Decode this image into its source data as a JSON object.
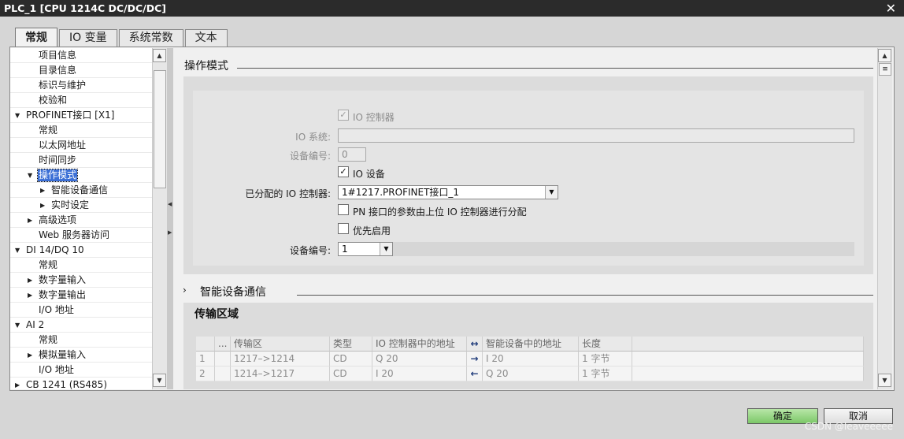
{
  "window": {
    "title": "PLC_1 [CPU 1214C DC/DC/DC]",
    "close": "✕"
  },
  "tabs": [
    {
      "label": "常规",
      "active": true
    },
    {
      "label": "IO 变量",
      "active": false
    },
    {
      "label": "系统常数",
      "active": false
    },
    {
      "label": "文本",
      "active": false
    }
  ],
  "tree": {
    "items": [
      {
        "label": "项目信息",
        "depth": 1,
        "arrow": ""
      },
      {
        "label": "目录信息",
        "depth": 1,
        "arrow": ""
      },
      {
        "label": "标识与维护",
        "depth": 1,
        "arrow": ""
      },
      {
        "label": "校验和",
        "depth": 1,
        "arrow": ""
      },
      {
        "label": "PROFINET接口 [X1]",
        "depth": 0,
        "arrow": "▼"
      },
      {
        "label": "常规",
        "depth": 1,
        "arrow": ""
      },
      {
        "label": "以太网地址",
        "depth": 1,
        "arrow": ""
      },
      {
        "label": "时间同步",
        "depth": 1,
        "arrow": ""
      },
      {
        "label": "操作模式",
        "depth": 1,
        "arrow": "▼",
        "selected": true
      },
      {
        "label": "智能设备通信",
        "depth": 2,
        "arrow": "▶"
      },
      {
        "label": "实时设定",
        "depth": 2,
        "arrow": "▶"
      },
      {
        "label": "高级选项",
        "depth": 1,
        "arrow": "▶"
      },
      {
        "label": "Web 服务器访问",
        "depth": 1,
        "arrow": ""
      },
      {
        "label": "DI 14/DQ 10",
        "depth": 0,
        "arrow": "▼"
      },
      {
        "label": "常规",
        "depth": 1,
        "arrow": ""
      },
      {
        "label": "数字量输入",
        "depth": 1,
        "arrow": "▶"
      },
      {
        "label": "数字量输出",
        "depth": 1,
        "arrow": "▶"
      },
      {
        "label": "I/O 地址",
        "depth": 1,
        "arrow": ""
      },
      {
        "label": "AI 2",
        "depth": 0,
        "arrow": "▼"
      },
      {
        "label": "常规",
        "depth": 1,
        "arrow": ""
      },
      {
        "label": "模拟量输入",
        "depth": 1,
        "arrow": "▶"
      },
      {
        "label": "I/O 地址",
        "depth": 1,
        "arrow": ""
      },
      {
        "label": "CB 1241 (RS485)",
        "depth": 0,
        "arrow": "▶"
      }
    ]
  },
  "section_operating_mode": {
    "title": "操作模式",
    "io_controller": {
      "label": "IO 控制器",
      "checked": true,
      "disabled": true
    },
    "io_system": {
      "label": "IO 系统:",
      "value": ""
    },
    "device_number_disabled": {
      "label": "设备编号:",
      "value": "0"
    },
    "io_device": {
      "label": "IO 设备",
      "checked": true
    },
    "assigned_controller": {
      "label": "已分配的 IO 控制器:",
      "value": "1#1217.PROFINET接口_1"
    },
    "pn_params": {
      "label": "PN 接口的参数由上位 IO 控制器进行分配",
      "checked": false
    },
    "priority_startup": {
      "label": "优先启用",
      "checked": false
    },
    "device_number": {
      "label": "设备编号:",
      "value": "1"
    }
  },
  "section_intelligent": {
    "title": "智能设备通信",
    "expand_arrow": "›",
    "transfer_title": "传输区域",
    "columns": [
      "",
      "...",
      "传输区",
      "类型",
      "IO 控制器中的地址",
      "↔",
      "智能设备中的地址",
      "长度"
    ],
    "rows": [
      {
        "num": "1",
        "name": "1217–>1214",
        "type": "CD",
        "ctrl_addr": "Q 20",
        "dir": "→",
        "dev_addr": "I 20",
        "len": "1 字节"
      },
      {
        "num": "2",
        "name": "1214–>1217",
        "type": "CD",
        "ctrl_addr": "I 20",
        "dir": "←",
        "dev_addr": "Q 20",
        "len": "1 字节"
      }
    ]
  },
  "buttons": {
    "ok": "确定",
    "cancel": "取消"
  },
  "watermark": "CSDN @leaveeeee"
}
